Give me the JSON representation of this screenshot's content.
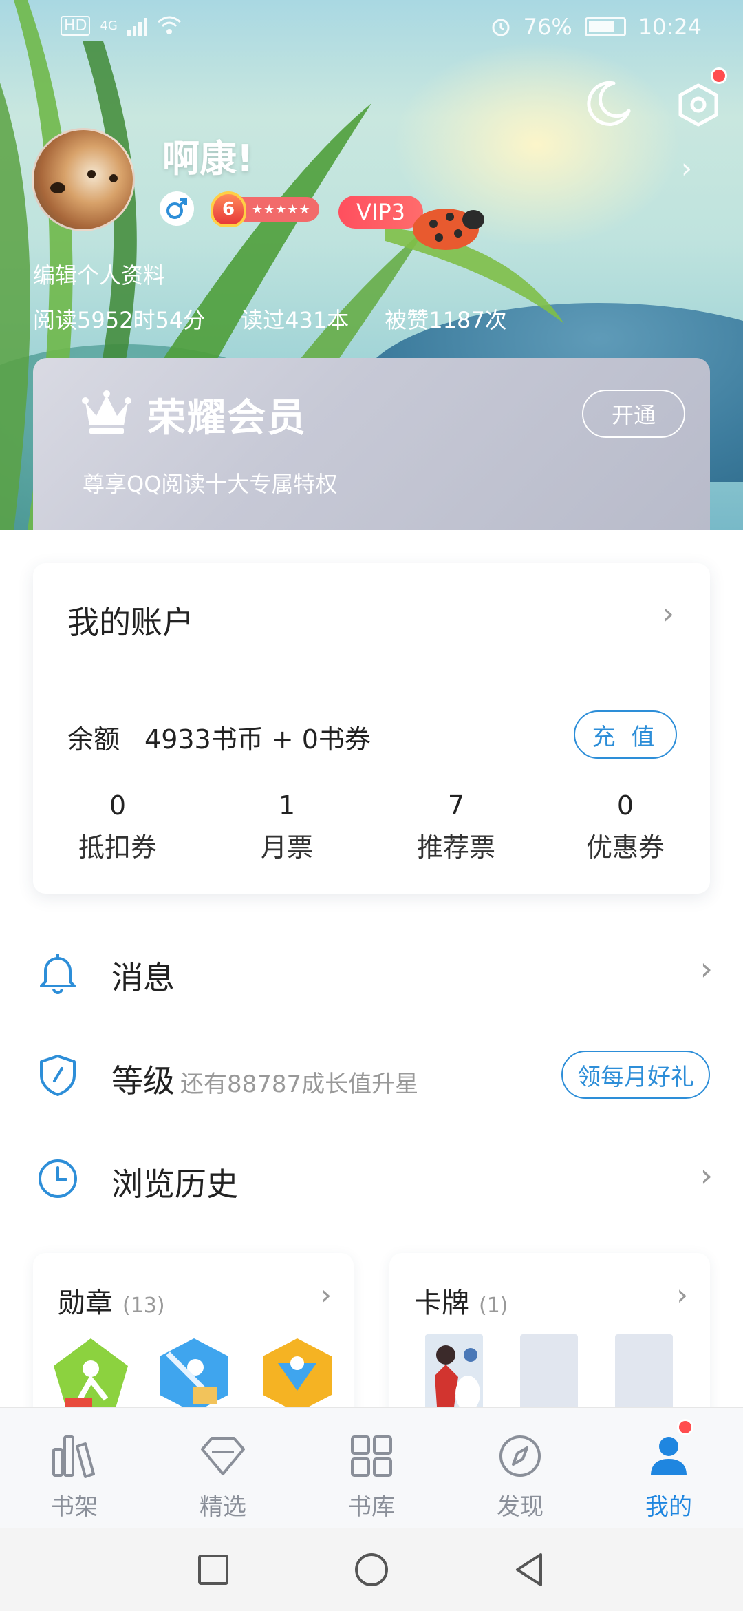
{
  "status_bar": {
    "left_label": "HD",
    "network": "4G",
    "battery": "76%",
    "time": "10:24"
  },
  "profile": {
    "username": "啊康!",
    "level": "6",
    "vip": "VIP3",
    "edit_label": "编辑个人资料",
    "stats": [
      "阅读5952时54分",
      "读过431本",
      "被赞1187次"
    ]
  },
  "member": {
    "title": "荣耀会员",
    "subtitle": "尊享QQ阅读十大专属特权",
    "open_label": "开通"
  },
  "account": {
    "title": "我的账户",
    "balance_label": "余额",
    "balance_value": "4933书币 + 0书券",
    "recharge_label": "充 值",
    "items": [
      {
        "value": "0",
        "label": "抵扣券"
      },
      {
        "value": "1",
        "label": "月票"
      },
      {
        "value": "7",
        "label": "推荐票"
      },
      {
        "value": "0",
        "label": "优惠券"
      }
    ]
  },
  "menu": {
    "messages": "消息",
    "level": "等级",
    "level_hint": "还有88787成长值升星",
    "gift_label": "领每月好礼",
    "history": "浏览历史"
  },
  "medals": {
    "title": "勋章",
    "count": "(13)"
  },
  "cards": {
    "title": "卡牌",
    "count": "(1)"
  },
  "bottom_nav": [
    {
      "label": "书架",
      "icon": "bookshelf-icon"
    },
    {
      "label": "精选",
      "icon": "diamond-icon"
    },
    {
      "label": "书库",
      "icon": "grid-icon"
    },
    {
      "label": "发现",
      "icon": "compass-icon"
    },
    {
      "label": "我的",
      "icon": "person-icon"
    }
  ],
  "colors": {
    "accent": "#2d8ed8",
    "nav_active": "#1f86e0",
    "notification": "#ff4d4f",
    "vip": "#ff5a62"
  }
}
